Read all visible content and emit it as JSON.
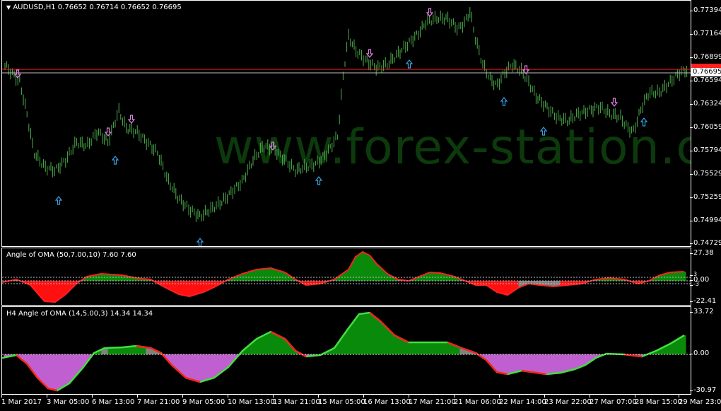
{
  "main": {
    "title": "AUDUSD,H1  0.76652 0.76714 0.76652 0.76695",
    "watermark": "www.forex-station.com",
    "price_labels": [
      "0.77394",
      "0.77164",
      "0.76899",
      "0.76695",
      "0.76594",
      "0.76324",
      "0.76059",
      "0.75794",
      "0.75529",
      "0.75259",
      "0.74994",
      "0.74729"
    ],
    "current_price": "0.76695",
    "colors": {
      "candles": "#4caf4c",
      "up_arrow": "#3aa0e0",
      "down_arrow": "#e080e0",
      "bid_line": "#c0c0c0",
      "ask_line": "#ff2020"
    }
  },
  "ind1": {
    "title": "Angle of OMA (50,7.00,10) 7.60 7.60",
    "levels": [
      "27.38",
      "3",
      "0.00",
      "-3",
      "-22.41"
    ],
    "colors": {
      "up": "#0a8a0a",
      "down": "#ff1010",
      "flat": "#808080"
    }
  },
  "ind2": {
    "title": "H4 Angle of OMA (14,5.00,3) 14.34 14.34",
    "levels": [
      "33.72",
      "0.00",
      "-30.97"
    ],
    "colors": {
      "up": "#0a8a0a",
      "down": "#c060d0",
      "flat": "#808080",
      "line": "#40e040"
    }
  },
  "xaxis": [
    "1 Mar 2017",
    "3 Mar 05:00",
    "6 Mar 13:00",
    "7 Mar 21:00",
    "9 Mar 05:00",
    "10 Mar 13:00",
    "13 Mar 21:00",
    "15 Mar 05:00",
    "16 Mar 13:00",
    "17 Mar 21:00",
    "21 Mar 06:00",
    "22 Mar 14:00",
    "23 Mar 22:00",
    "27 Mar 07:00",
    "28 Mar 15:00",
    "29 Mar 23:00"
  ]
}
